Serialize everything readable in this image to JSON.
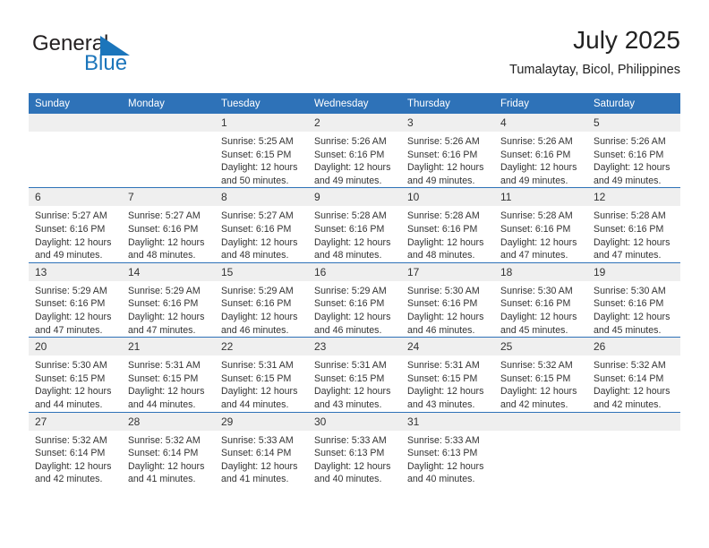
{
  "brand": {
    "name_part1": "General",
    "name_part2": "Blue",
    "colors": {
      "accent": "#1b75bb",
      "header": "#2e72b8",
      "band": "#efefef"
    }
  },
  "header": {
    "title": "July 2025",
    "subtitle": "Tumalaytay, Bicol, Philippines"
  },
  "weekdays": [
    "Sunday",
    "Monday",
    "Tuesday",
    "Wednesday",
    "Thursday",
    "Friday",
    "Saturday"
  ],
  "labels": {
    "sunrise": "Sunrise:",
    "sunset": "Sunset:",
    "daylight": "Daylight:"
  },
  "weeks": [
    [
      {
        "day": "",
        "sunrise": "",
        "sunset": "",
        "daylight": ""
      },
      {
        "day": "",
        "sunrise": "",
        "sunset": "",
        "daylight": ""
      },
      {
        "day": "1",
        "sunrise": "Sunrise: 5:25 AM",
        "sunset": "Sunset: 6:15 PM",
        "daylight": "Daylight: 12 hours and 50 minutes."
      },
      {
        "day": "2",
        "sunrise": "Sunrise: 5:26 AM",
        "sunset": "Sunset: 6:16 PM",
        "daylight": "Daylight: 12 hours and 49 minutes."
      },
      {
        "day": "3",
        "sunrise": "Sunrise: 5:26 AM",
        "sunset": "Sunset: 6:16 PM",
        "daylight": "Daylight: 12 hours and 49 minutes."
      },
      {
        "day": "4",
        "sunrise": "Sunrise: 5:26 AM",
        "sunset": "Sunset: 6:16 PM",
        "daylight": "Daylight: 12 hours and 49 minutes."
      },
      {
        "day": "5",
        "sunrise": "Sunrise: 5:26 AM",
        "sunset": "Sunset: 6:16 PM",
        "daylight": "Daylight: 12 hours and 49 minutes."
      }
    ],
    [
      {
        "day": "6",
        "sunrise": "Sunrise: 5:27 AM",
        "sunset": "Sunset: 6:16 PM",
        "daylight": "Daylight: 12 hours and 49 minutes."
      },
      {
        "day": "7",
        "sunrise": "Sunrise: 5:27 AM",
        "sunset": "Sunset: 6:16 PM",
        "daylight": "Daylight: 12 hours and 48 minutes."
      },
      {
        "day": "8",
        "sunrise": "Sunrise: 5:27 AM",
        "sunset": "Sunset: 6:16 PM",
        "daylight": "Daylight: 12 hours and 48 minutes."
      },
      {
        "day": "9",
        "sunrise": "Sunrise: 5:28 AM",
        "sunset": "Sunset: 6:16 PM",
        "daylight": "Daylight: 12 hours and 48 minutes."
      },
      {
        "day": "10",
        "sunrise": "Sunrise: 5:28 AM",
        "sunset": "Sunset: 6:16 PM",
        "daylight": "Daylight: 12 hours and 48 minutes."
      },
      {
        "day": "11",
        "sunrise": "Sunrise: 5:28 AM",
        "sunset": "Sunset: 6:16 PM",
        "daylight": "Daylight: 12 hours and 47 minutes."
      },
      {
        "day": "12",
        "sunrise": "Sunrise: 5:28 AM",
        "sunset": "Sunset: 6:16 PM",
        "daylight": "Daylight: 12 hours and 47 minutes."
      }
    ],
    [
      {
        "day": "13",
        "sunrise": "Sunrise: 5:29 AM",
        "sunset": "Sunset: 6:16 PM",
        "daylight": "Daylight: 12 hours and 47 minutes."
      },
      {
        "day": "14",
        "sunrise": "Sunrise: 5:29 AM",
        "sunset": "Sunset: 6:16 PM",
        "daylight": "Daylight: 12 hours and 47 minutes."
      },
      {
        "day": "15",
        "sunrise": "Sunrise: 5:29 AM",
        "sunset": "Sunset: 6:16 PM",
        "daylight": "Daylight: 12 hours and 46 minutes."
      },
      {
        "day": "16",
        "sunrise": "Sunrise: 5:29 AM",
        "sunset": "Sunset: 6:16 PM",
        "daylight": "Daylight: 12 hours and 46 minutes."
      },
      {
        "day": "17",
        "sunrise": "Sunrise: 5:30 AM",
        "sunset": "Sunset: 6:16 PM",
        "daylight": "Daylight: 12 hours and 46 minutes."
      },
      {
        "day": "18",
        "sunrise": "Sunrise: 5:30 AM",
        "sunset": "Sunset: 6:16 PM",
        "daylight": "Daylight: 12 hours and 45 minutes."
      },
      {
        "day": "19",
        "sunrise": "Sunrise: 5:30 AM",
        "sunset": "Sunset: 6:16 PM",
        "daylight": "Daylight: 12 hours and 45 minutes."
      }
    ],
    [
      {
        "day": "20",
        "sunrise": "Sunrise: 5:30 AM",
        "sunset": "Sunset: 6:15 PM",
        "daylight": "Daylight: 12 hours and 44 minutes."
      },
      {
        "day": "21",
        "sunrise": "Sunrise: 5:31 AM",
        "sunset": "Sunset: 6:15 PM",
        "daylight": "Daylight: 12 hours and 44 minutes."
      },
      {
        "day": "22",
        "sunrise": "Sunrise: 5:31 AM",
        "sunset": "Sunset: 6:15 PM",
        "daylight": "Daylight: 12 hours and 44 minutes."
      },
      {
        "day": "23",
        "sunrise": "Sunrise: 5:31 AM",
        "sunset": "Sunset: 6:15 PM",
        "daylight": "Daylight: 12 hours and 43 minutes."
      },
      {
        "day": "24",
        "sunrise": "Sunrise: 5:31 AM",
        "sunset": "Sunset: 6:15 PM",
        "daylight": "Daylight: 12 hours and 43 minutes."
      },
      {
        "day": "25",
        "sunrise": "Sunrise: 5:32 AM",
        "sunset": "Sunset: 6:15 PM",
        "daylight": "Daylight: 12 hours and 42 minutes."
      },
      {
        "day": "26",
        "sunrise": "Sunrise: 5:32 AM",
        "sunset": "Sunset: 6:14 PM",
        "daylight": "Daylight: 12 hours and 42 minutes."
      }
    ],
    [
      {
        "day": "27",
        "sunrise": "Sunrise: 5:32 AM",
        "sunset": "Sunset: 6:14 PM",
        "daylight": "Daylight: 12 hours and 42 minutes."
      },
      {
        "day": "28",
        "sunrise": "Sunrise: 5:32 AM",
        "sunset": "Sunset: 6:14 PM",
        "daylight": "Daylight: 12 hours and 41 minutes."
      },
      {
        "day": "29",
        "sunrise": "Sunrise: 5:33 AM",
        "sunset": "Sunset: 6:14 PM",
        "daylight": "Daylight: 12 hours and 41 minutes."
      },
      {
        "day": "30",
        "sunrise": "Sunrise: 5:33 AM",
        "sunset": "Sunset: 6:13 PM",
        "daylight": "Daylight: 12 hours and 40 minutes."
      },
      {
        "day": "31",
        "sunrise": "Sunrise: 5:33 AM",
        "sunset": "Sunset: 6:13 PM",
        "daylight": "Daylight: 12 hours and 40 minutes."
      },
      {
        "day": "",
        "sunrise": "",
        "sunset": "",
        "daylight": ""
      },
      {
        "day": "",
        "sunrise": "",
        "sunset": "",
        "daylight": ""
      }
    ]
  ]
}
